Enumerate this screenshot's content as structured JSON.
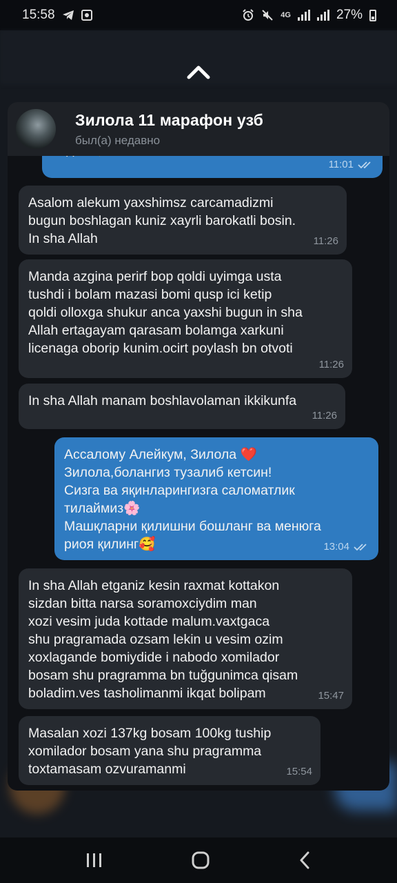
{
  "status_bar": {
    "time": "15:58",
    "battery": "27%",
    "network": "4G"
  },
  "chat": {
    "title": "Зилола 11 марафон узб",
    "status": "был(а) недавно"
  },
  "messages": [
    {
      "direction": "out",
      "text": "видео✨",
      "time": "11:01",
      "read": true
    },
    {
      "direction": "in",
      "text": "Asalom alekum yaxshimsz carcamadizmi\nbugun boshlagan kuniz xayrli barokatli bosin.\nIn sha Allah",
      "time": "11:26"
    },
    {
      "direction": "in",
      "text": "Manda azgina perirf bop qoldi uyimga usta\ntushdi i bolam mazasi bomi qusp ici ketip\nqoldi olloxga shukur anca yaxshi bugun in sha\nAllah ertagayam qarasam bolamga xarkuni\nlicenaga oborip kunim.ocirt poylash bn otvoti",
      "time": "11:26"
    },
    {
      "direction": "in",
      "text": "In sha Allah manam boshlavolaman ikkikunfa",
      "time": "11:26"
    },
    {
      "direction": "out",
      "text": "Ассалому Алейкум, Зилола ❤️\nЗилола,болангиз тузалиб кетсин!\nСизга ва яқинларингизга саломатлик\nтилаймиз🌸\nМашқларни қилишни бошланг ва менюга\nриоя қилинг🥰",
      "time": "13:04",
      "read": true
    },
    {
      "direction": "in",
      "text": "In sha Allah etganiz kesin raxmat kottakon\nsizdan bitta narsa soramoxciydim man\nxozi vesim juda kottade  malum.vaxtgaca\nshu pragramada ozsam lekin u vesim ozim\nxoxlagande bomiydide i nabodo xomilador\nbosam shu pragramma bn tuğgunimca qisam\nboladim.ves tasholimanmi ikqat bolipam",
      "time": "15:47"
    },
    {
      "direction": "in",
      "text": "Masalan xozi 137kg bosam 100kg tuship\nxomilador bosam yana shu pragramma\ntoxtamasam ozvuramanmi",
      "time": "15:54"
    }
  ],
  "icons": {
    "status": [
      "telegram-icon",
      "gallery-icon",
      "alarm-icon",
      "mute-icon",
      "signal-icon",
      "battery-icon"
    ],
    "nav": [
      "recents-icon",
      "home-icon",
      "back-icon"
    ]
  }
}
